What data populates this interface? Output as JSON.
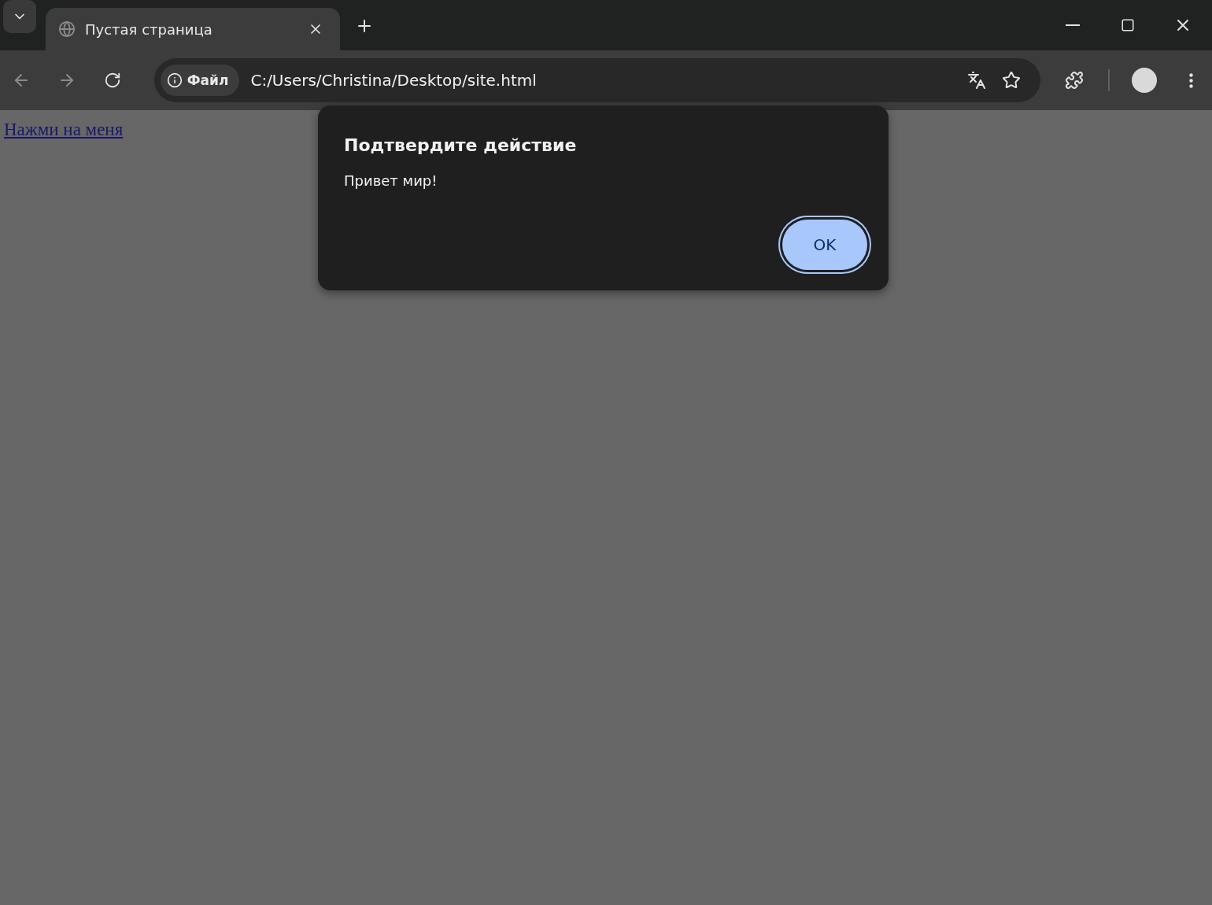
{
  "tabs": [
    {
      "title": "Пустая страница",
      "selected": true
    }
  ],
  "address_bar": {
    "security_chip": "Файл",
    "url": "C:/Users/Christina/Desktop/site.html"
  },
  "page": {
    "link": "Нажми на меня"
  },
  "dialog": {
    "title": "Подтвердите действие",
    "message": "Привет мир!",
    "buttons": [
      {
        "label": "OK",
        "focused": true
      }
    ]
  }
}
